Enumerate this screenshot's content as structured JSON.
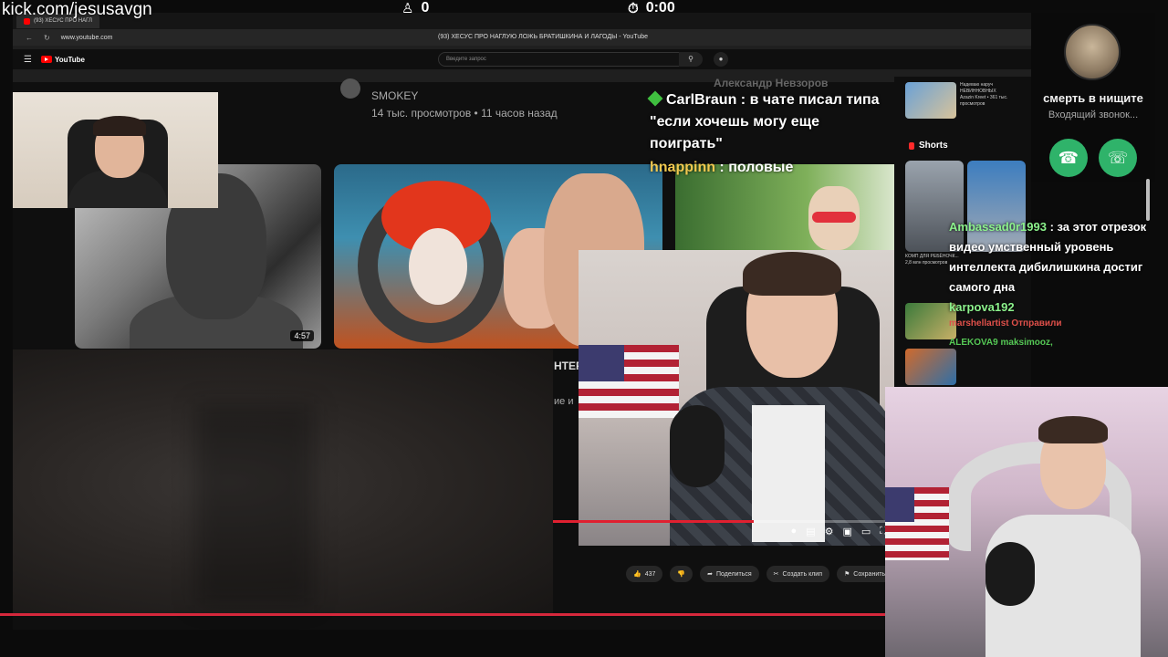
{
  "overlay": {
    "kick_url": "kick.com/jesusavgn",
    "viewers": "0",
    "timer": "0:00"
  },
  "browser": {
    "tab_title": "(93) ХЕСУС ПРО НАГЛ",
    "url": "www.youtube.com",
    "page_title": "(93) ХЕСУС ПРО НАГЛУЮ ЛОЖЬ БРАТИШКИНА И ЛАГОДЫ - YouTube"
  },
  "youtube": {
    "logo": "YouTube",
    "search_placeholder": "Введите запрос"
  },
  "feed": {
    "video_channel": "SMOKEY",
    "video_stats": "14 тыс. просмотров • 11 часов назад",
    "thumb_duration": "4:57",
    "partial_title": "НТЕР",
    "partial_sub": "ие и"
  },
  "actions": {
    "likes": "437",
    "share": "Поделиться",
    "clip": "Создать клип",
    "save": "Сохранить"
  },
  "chat_center": {
    "ghost_1": "Александр Невзоров",
    "messages": [
      {
        "user": "CarlBraun",
        "text": " : в чате писал типа \"если хочешь могу еще поиграть\""
      },
      {
        "user": "hnappinn",
        "text": " : половые"
      }
    ]
  },
  "sidebar": {
    "card_1": "Надеваю наруч НЕВИННОВНЫХ",
    "card_1_meta": "Azazin Kreet • 361 тыс. просмотров",
    "shorts": "Shorts",
    "shorts_cap_1": "КОМП ДЛЯ РЕБЁНОЧК...",
    "shorts_cap_2": "2,8 млн просмотров"
  },
  "chat_right": {
    "messages": [
      {
        "user": "Ambassad0r1993",
        "text": " : за этот отрезок видео умственный уровень интеллекта дибилишкина достиг самого дна"
      },
      {
        "user": "karpova192",
        "text": ""
      }
    ],
    "ghost_lines": [
      "marshellartist Отправили",
      "ALEKOVA9 maksimooz,"
    ]
  },
  "call": {
    "name": "смерть в нищите",
    "status": "Входящий звонок..."
  },
  "colors": {
    "accent_red": "#d6283c",
    "call_green": "#2fb36a",
    "chat_user_green": "#8cf28c"
  }
}
